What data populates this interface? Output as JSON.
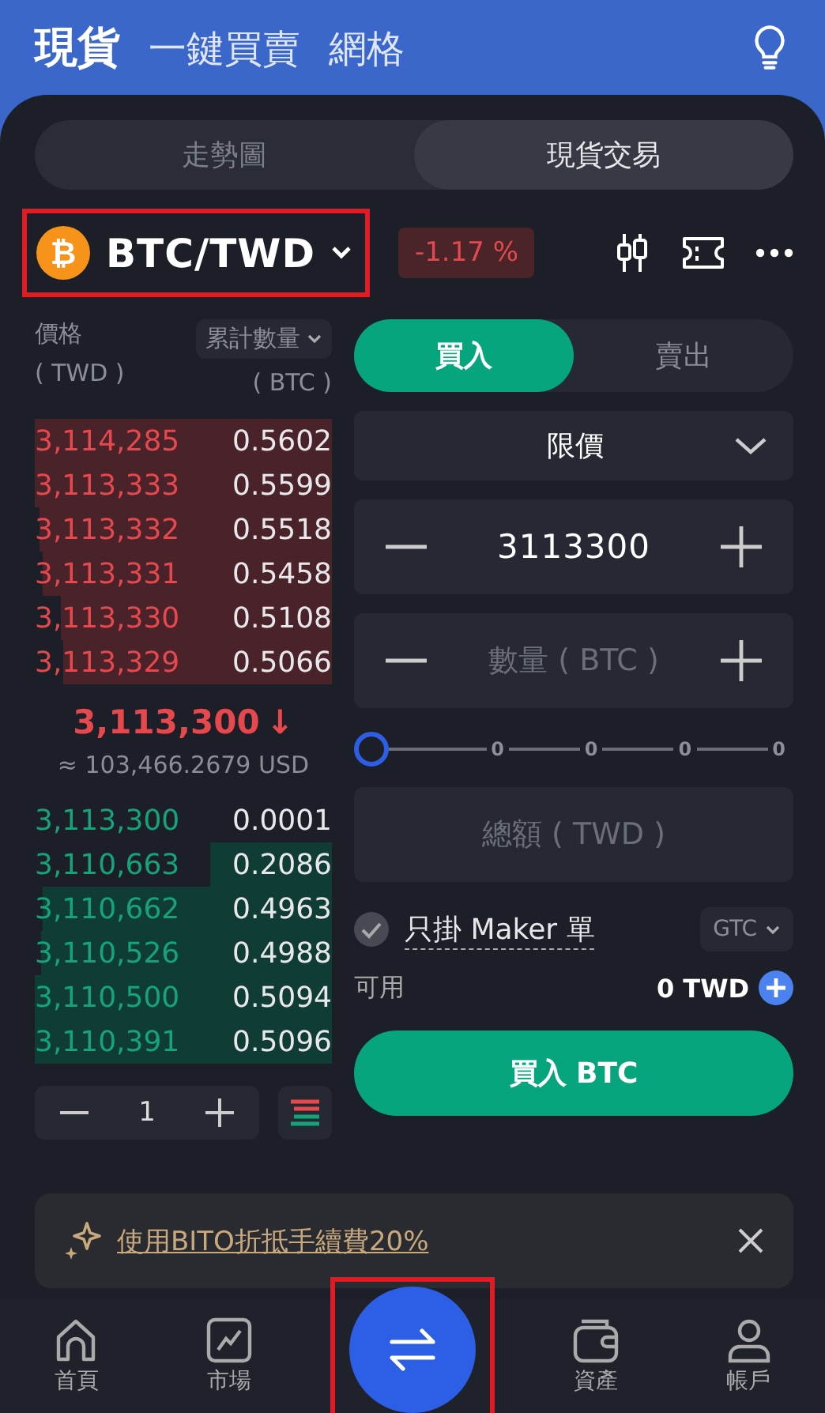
{
  "header_tabs": [
    {
      "label": "現貨",
      "selected": true
    },
    {
      "label": "一鍵買賣",
      "selected": false
    },
    {
      "label": "網格",
      "selected": false
    }
  ],
  "view_tabs": [
    {
      "label": "走勢圖",
      "selected": false
    },
    {
      "label": "現貨交易",
      "selected": true
    }
  ],
  "pair": {
    "symbol": "BTC/TWD",
    "coin_glyph": "₿",
    "highlighted": true,
    "change": "-1.17 %"
  },
  "order_book": {
    "price_label": "價格",
    "price_unit": "( TWD )",
    "amount_selector": "累計數量",
    "amount_unit": "( BTC )",
    "asks": [
      {
        "price": "3,114,285",
        "amount": "0.5602"
      },
      {
        "price": "3,113,333",
        "amount": "0.5599"
      },
      {
        "price": "3,113,332",
        "amount": "0.5518"
      },
      {
        "price": "3,113,331",
        "amount": "0.5458"
      },
      {
        "price": "3,113,330",
        "amount": "0.5108"
      },
      {
        "price": "3,113,329",
        "amount": "0.5066"
      }
    ],
    "last_price": "3,113,300",
    "last_arrow": "↓",
    "usd_value": "≈ 103,466.2679 USD",
    "bids": [
      {
        "price": "3,113,300",
        "amount": "0.0001"
      },
      {
        "price": "3,110,663",
        "amount": "0.2086"
      },
      {
        "price": "3,110,662",
        "amount": "0.4963"
      },
      {
        "price": "3,110,526",
        "amount": "0.4988"
      },
      {
        "price": "3,110,500",
        "amount": "0.5094"
      },
      {
        "price": "3,110,391",
        "amount": "0.5096"
      }
    ],
    "precision": "1"
  },
  "side_tabs": [
    {
      "label": "買入",
      "selected": true
    },
    {
      "label": "賣出",
      "selected": false
    }
  ],
  "order_type": "限價",
  "price_value": "3113300",
  "amount_placeholder": "數量 ( BTC )",
  "slider": {
    "level": 0,
    "ticks": [
      "0",
      "0",
      "0",
      "0"
    ]
  },
  "total_placeholder": "總額 ( TWD )",
  "maker_only": {
    "label": "只掛 Maker 單"
  },
  "time_in_force": "GTC",
  "available": {
    "label": "可用",
    "value": "0 TWD"
  },
  "submit": "買入 BTC",
  "banner": {
    "text": "使用BITO折抵手續費20%"
  },
  "nav": [
    {
      "kind": "home",
      "label": "首頁",
      "highlighted": false
    },
    {
      "kind": "market",
      "label": "市場",
      "highlighted": false
    },
    {
      "kind": "trade",
      "highlighted": true
    },
    {
      "kind": "wallet",
      "label": "資產",
      "highlighted": false
    },
    {
      "kind": "account",
      "label": "帳戶",
      "highlighted": false
    }
  ]
}
